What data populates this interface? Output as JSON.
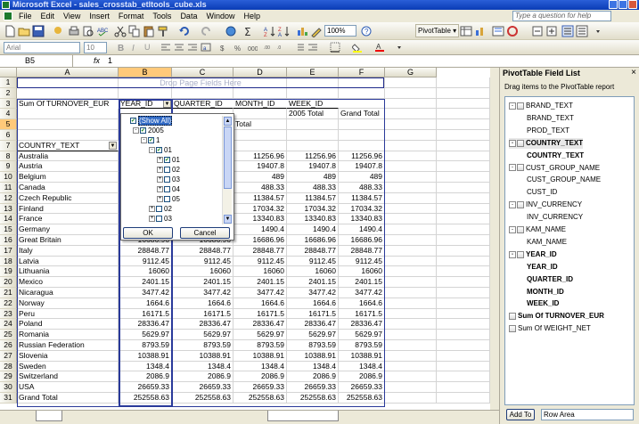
{
  "window": {
    "title": "Microsoft Excel - sales_crosstab_etltools_cube.xls"
  },
  "menu": [
    "File",
    "Edit",
    "View",
    "Insert",
    "Format",
    "Tools",
    "Data",
    "Window",
    "Help"
  ],
  "ask_placeholder": "Type a question for help",
  "toolbar": {
    "zoom": "100%",
    "pivottable_label": "PivotTable ▾",
    "font": "Arial",
    "size": "10"
  },
  "formula": {
    "cell": "B5",
    "fx": "fx",
    "value": "1"
  },
  "columns": [
    "A",
    "B",
    "C",
    "D",
    "E",
    "F",
    "G"
  ],
  "rows": [
    "1",
    "2",
    "3",
    "4",
    "5",
    "6",
    "7",
    "8",
    "9",
    "10",
    "11",
    "12",
    "13",
    "14",
    "15",
    "16",
    "17",
    "18",
    "19",
    "20",
    "21",
    "22",
    "23",
    "24",
    "25",
    "26",
    "27",
    "28",
    "29",
    "30",
    "31"
  ],
  "drop_page": "Drop Page Fields Here",
  "pivot": {
    "data_field": "Sum Of TURNOVER_EUR",
    "col_fields": [
      "YEAR_ID",
      "QUARTER_ID",
      "MONTH_ID",
      "WEEK_ID"
    ],
    "year_total": "2005 Total",
    "grand_total": "Grand Total",
    "total": "Total",
    "row_field": "COUNTRY_TEXT",
    "rows": [
      [
        "Australia",
        "11256.96",
        "11256.96",
        "11256.96",
        "11256.96",
        "11256.96"
      ],
      [
        "Austria",
        "19407.8",
        "19407.8",
        "19407.8",
        "19407.8",
        "19407.8"
      ],
      [
        "Belgium",
        "489",
        "489",
        "489",
        "489",
        "489"
      ],
      [
        "Canada",
        "488.33",
        "488.33",
        "488.33",
        "488.33",
        "488.33"
      ],
      [
        "Czech Republic",
        "11384.57",
        "11384.57",
        "11384.57",
        "11384.57",
        "11384.57"
      ],
      [
        "Finland",
        "17034.32",
        "17034.32",
        "17034.32",
        "17034.32",
        "17034.32"
      ],
      [
        "France",
        "13340.83",
        "13340.83",
        "13340.83",
        "13340.83",
        "13340.83"
      ],
      [
        "Germany",
        "1490.4",
        "1490.4",
        "1490.4",
        "1490.4",
        "1490.4"
      ],
      [
        "Great Britain",
        "16686.96",
        "16686.96",
        "16686.96",
        "16686.96",
        "16686.96"
      ],
      [
        "Italy",
        "28848.77",
        "28848.77",
        "28848.77",
        "28848.77",
        "28848.77"
      ],
      [
        "Latvia",
        "9112.45",
        "9112.45",
        "9112.45",
        "9112.45",
        "9112.45"
      ],
      [
        "Lithuania",
        "16060",
        "16060",
        "16060",
        "16060",
        "16060"
      ],
      [
        "Mexico",
        "2401.15",
        "2401.15",
        "2401.15",
        "2401.15",
        "2401.15"
      ],
      [
        "Nicaragua",
        "3477.42",
        "3477.42",
        "3477.42",
        "3477.42",
        "3477.42"
      ],
      [
        "Norway",
        "1664.6",
        "1664.6",
        "1664.6",
        "1664.6",
        "1664.6"
      ],
      [
        "Peru",
        "16171.5",
        "16171.5",
        "16171.5",
        "16171.5",
        "16171.5"
      ],
      [
        "Poland",
        "28336.47",
        "28336.47",
        "28336.47",
        "28336.47",
        "28336.47"
      ],
      [
        "Romania",
        "5629.97",
        "5629.97",
        "5629.97",
        "5629.97",
        "5629.97"
      ],
      [
        "Russian Federation",
        "8793.59",
        "8793.59",
        "8793.59",
        "8793.59",
        "8793.59"
      ],
      [
        "Slovenia",
        "10388.91",
        "10388.91",
        "10388.91",
        "10388.91",
        "10388.91"
      ],
      [
        "Sweden",
        "1348.4",
        "1348.4",
        "1348.4",
        "1348.4",
        "1348.4"
      ],
      [
        "Switzerland",
        "2086.9",
        "2086.9",
        "2086.9",
        "2086.9",
        "2086.9"
      ],
      [
        "USA",
        "26659.33",
        "26659.33",
        "26659.33",
        "26659.33",
        "26659.33"
      ],
      [
        "Grand Total",
        "252558.63",
        "252558.63",
        "252558.63",
        "252558.63",
        "252558.63"
      ]
    ]
  },
  "filter_popup": {
    "tree": [
      {
        "label": "(Show All)",
        "level": 0,
        "checked": true,
        "sel": true
      },
      {
        "label": "2005",
        "level": 1,
        "checked": true,
        "exp": "-"
      },
      {
        "label": "1",
        "level": 2,
        "checked": true,
        "exp": "-"
      },
      {
        "label": "01",
        "level": 3,
        "checked": true,
        "exp": "-"
      },
      {
        "label": "01",
        "level": 4,
        "checked": true,
        "exp": "+"
      },
      {
        "label": "02",
        "level": 4,
        "checked": false,
        "exp": "+"
      },
      {
        "label": "03",
        "level": 4,
        "checked": false,
        "exp": "+"
      },
      {
        "label": "04",
        "level": 4,
        "checked": false,
        "exp": "+"
      },
      {
        "label": "05",
        "level": 4,
        "checked": false,
        "exp": "+"
      },
      {
        "label": "02",
        "level": 3,
        "checked": false,
        "exp": "+"
      },
      {
        "label": "03",
        "level": 3,
        "checked": false,
        "exp": "+"
      }
    ],
    "ok": "OK",
    "cancel": "Cancel"
  },
  "field_list": {
    "title": "PivotTable Field List",
    "hint": "Drag items to the PivotTable report",
    "items": [
      {
        "label": "BRAND_TEXT",
        "level": 0,
        "exp": "-"
      },
      {
        "label": "BRAND_TEXT",
        "level": 1
      },
      {
        "label": "PROD_TEXT",
        "level": 1
      },
      {
        "label": "COUNTRY_TEXT",
        "level": 0,
        "exp": "-",
        "bold": true,
        "hl": true
      },
      {
        "label": "COUNTRY_TEXT",
        "level": 1,
        "bold": true
      },
      {
        "label": "CUST_GROUP_NAME",
        "level": 0,
        "exp": "-"
      },
      {
        "label": "CUST_GROUP_NAME",
        "level": 1
      },
      {
        "label": "CUST_ID",
        "level": 1
      },
      {
        "label": "INV_CURRENCY",
        "level": 0,
        "exp": "-"
      },
      {
        "label": "INV_CURRENCY",
        "level": 1
      },
      {
        "label": "KAM_NAME",
        "level": 0,
        "exp": "-"
      },
      {
        "label": "KAM_NAME",
        "level": 1
      },
      {
        "label": "YEAR_ID",
        "level": 0,
        "exp": "-",
        "bold": true
      },
      {
        "label": "YEAR_ID",
        "level": 1,
        "bold": true
      },
      {
        "label": "QUARTER_ID",
        "level": 1,
        "bold": true
      },
      {
        "label": "MONTH_ID",
        "level": 1,
        "bold": true
      },
      {
        "label": "WEEK_ID",
        "level": 1,
        "bold": true
      },
      {
        "label": "Sum Of TURNOVER_EUR",
        "level": 0,
        "bold": true,
        "fieldicon": true
      },
      {
        "label": "Sum Of WEIGHT_NET",
        "level": 0,
        "fieldicon": true
      }
    ],
    "add_to": "Add To",
    "area": "Row Area"
  }
}
